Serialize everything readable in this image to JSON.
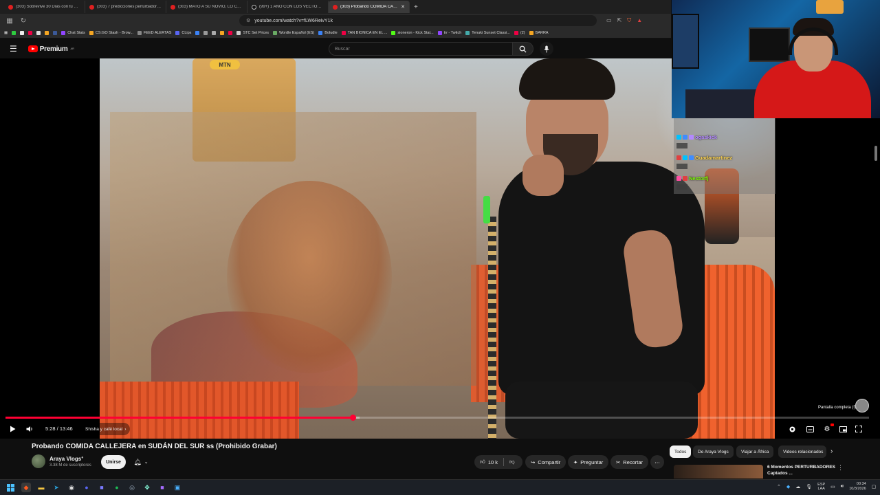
{
  "browser": {
    "tabs": [
      {
        "label": "(303) Sobrevive 30 Días con tu Ex en",
        "icon": "youtube-icon",
        "active": false
      },
      {
        "label": "(303) 7 predicciones perturbadoras q",
        "icon": "youtube-icon",
        "active": false
      },
      {
        "label": "(303) MATÓ A SU NOVIO, LO COCINÓ",
        "icon": "youtube-icon",
        "active": false
      },
      {
        "label": "(99+) 1 AÑO CON LOS VECTORGAS",
        "icon": "tiktok-icon",
        "active": false
      },
      {
        "label": "(303) Probando COMIDA CALLE",
        "icon": "youtube-icon",
        "active": true
      }
    ],
    "url": "youtube.com/watch?v=fLW6ReivY1k",
    "bookmarks": [
      "Chat Stats",
      "CS:GO Stash - Brow...",
      "FEED ALERTAS",
      "CLips",
      "STC Set Prices",
      "Wordle Español (ES)",
      "Boludle",
      "TAN BIONICA EN EL ...",
      "sioneron - Kick Stat...",
      "trr - Twitch",
      "Tenuki Sunset Classi...",
      "(2)",
      "BARRA"
    ]
  },
  "youtube": {
    "logo_text": "Premium",
    "logo_sup": "AR",
    "search_placeholder": "Buscar"
  },
  "video_scene": {
    "kiosk_sign": "MTN"
  },
  "chat": {
    "messages": [
      {
        "user": "ogaskick",
        "color": "#b388ff"
      },
      {
        "user": "Guadamartinez",
        "color": "#ffd54f"
      },
      {
        "user": "Nestorfj",
        "color": "#7CFC00"
      }
    ]
  },
  "player": {
    "progress_played_fraction": 0.402,
    "progress_loaded_fraction": 0.41,
    "time_display": "5:28 / 13:46",
    "chapter": "Shisha y café local",
    "fullscreen_tooltip": "Pantalla completa (f)"
  },
  "video": {
    "title": "Probando COMIDA CALLEJERA en SUDÁN DEL SUR ss (Prohibido Grabar)",
    "channel": "Araya Vlogs",
    "subscribers": "3.38 M de suscriptores",
    "join_label": "Unirse",
    "likes": "10 k",
    "share_label": "Compartir",
    "ask_label": "Preguntar",
    "clip_label": "Recortar"
  },
  "rail": {
    "chips": [
      "Todos",
      "De Araya Vlogs",
      "Viajar a África",
      "Videos relacionados"
    ],
    "recommendation_title": "6 Momentos PERTURBADORES Captados ..."
  },
  "taskbar": {
    "lang_line1": "ESP",
    "lang_line2": "LAA",
    "time": "00:34",
    "date": "10/3/2026"
  },
  "colors": {
    "youtube_red": "#ff0000",
    "progress_red": "#ff0033",
    "background": "#0f0f0f"
  }
}
